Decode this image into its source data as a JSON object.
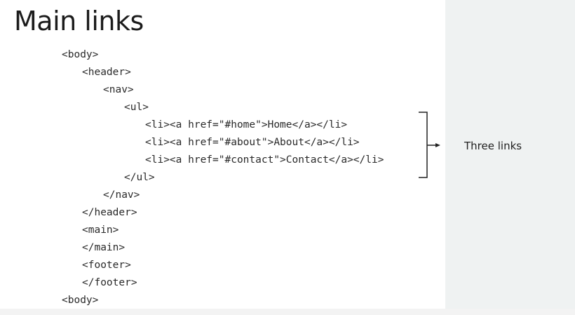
{
  "title": "Main links",
  "code": {
    "lines": [
      "<body>",
      "<header>",
      "<nav>",
      "<ul>",
      "<li><a href=\"#home\">Home</a></li>",
      "<li><a href=\"#about\">About</a></li>",
      "<li><a href=\"#contact\">Contact</a></li>",
      "</ul>",
      "</nav>",
      "</header>",
      "<main>",
      "</main>",
      "<footer>",
      "</footer>",
      "<body>"
    ]
  },
  "annotation": {
    "label": "Three links"
  }
}
